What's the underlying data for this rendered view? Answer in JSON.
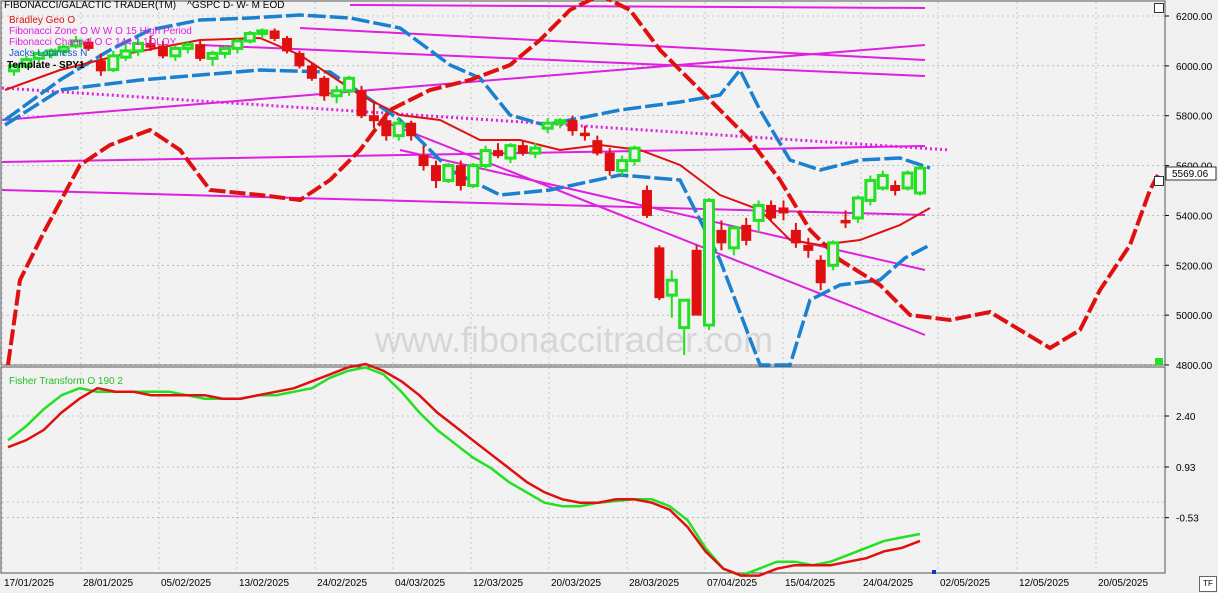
{
  "header": {
    "app_title": "FIBONACCI/GALACTIC TRADER(TM)",
    "symbol_line": "^GSPC D- W- M EOD",
    "indicators": [
      {
        "label": "Bradley Geo O",
        "color": "#e01010"
      },
      {
        "label": "Fibonacci Zone O  W W O 15 High Period",
        "color": "#e020e0"
      },
      {
        "label": "Fibonacci Channel O C 144 1 1OLOY",
        "color": "#e020e0"
      },
      {
        "label": "Jacks Lopiness N",
        "color": "#1060d0"
      }
    ],
    "template": "Template - SPY1"
  },
  "watermark": "www.fibonaccitrader.com",
  "price_axis": {
    "ticks": [
      "6200.00",
      "6000.00",
      "5800.00",
      "5600.00",
      "5400.00",
      "5200.00",
      "5000.00",
      "4800.00"
    ],
    "last_price": "5569.06"
  },
  "lower_panel": {
    "title": "Fisher Transform O 190 2",
    "ticks": [
      "2.40",
      "0.93",
      "-0.53"
    ]
  },
  "x_axis": {
    "dates": [
      "17/01/2025",
      "28/01/2025",
      "05/02/2025",
      "13/02/2025",
      "24/02/2025",
      "04/03/2025",
      "12/03/2025",
      "20/03/2025",
      "28/03/2025",
      "07/04/2025",
      "15/04/2025",
      "24/04/2025",
      "02/05/2025",
      "12/05/2025",
      "20/05/2025"
    ]
  },
  "buttons": {
    "tf": "TF"
  },
  "colors": {
    "up": "#22e022",
    "down": "#e01010",
    "bradley": "#e01010",
    "fib": "#e020e0",
    "jacks": "#1a80d0",
    "fisher_a": "#22e022",
    "fisher_b": "#e01010"
  },
  "chart_data": [
    {
      "type": "candlestick",
      "title": "^GSPC D- W- M EOD",
      "ylim": [
        4800,
        6300
      ],
      "y_ticks": [
        6200,
        6000,
        5800,
        5600,
        5400,
        5200,
        5000,
        4800
      ],
      "x_tick_labels": [
        "17/01/2025",
        "28/01/2025",
        "05/02/2025",
        "13/02/2025",
        "24/02/2025",
        "04/03/2025",
        "12/03/2025",
        "20/03/2025",
        "28/03/2025",
        "07/04/2025",
        "15/04/2025",
        "24/04/2025",
        "02/05/2025",
        "12/05/2025",
        "20/05/2025"
      ],
      "last_price": 5569.06,
      "candles": [
        {
          "o": 5980,
          "h": 6010,
          "l": 5960,
          "c": 6000
        },
        {
          "o": 6000,
          "h": 6040,
          "l": 5990,
          "c": 6025
        },
        {
          "o": 6030,
          "h": 6060,
          "l": 6015,
          "c": 6050
        },
        {
          "o": 6045,
          "h": 6070,
          "l": 6030,
          "c": 6060
        },
        {
          "o": 6060,
          "h": 6085,
          "l": 6040,
          "c": 6075
        },
        {
          "o": 6080,
          "h": 6120,
          "l": 6070,
          "c": 6100
        },
        {
          "o": 6095,
          "h": 6110,
          "l": 6060,
          "c": 6070
        },
        {
          "o": 6020,
          "h": 6050,
          "l": 5960,
          "c": 5980
        },
        {
          "o": 5985,
          "h": 6060,
          "l": 5975,
          "c": 6040
        },
        {
          "o": 6035,
          "h": 6090,
          "l": 6020,
          "c": 6060
        },
        {
          "o": 6060,
          "h": 6110,
          "l": 6040,
          "c": 6090
        },
        {
          "o": 6090,
          "h": 6120,
          "l": 6060,
          "c": 6075
        },
        {
          "o": 6080,
          "h": 6100,
          "l": 6030,
          "c": 6040
        },
        {
          "o": 6040,
          "h": 6080,
          "l": 6020,
          "c": 6070
        },
        {
          "o": 6070,
          "h": 6100,
          "l": 6050,
          "c": 6085
        },
        {
          "o": 6085,
          "h": 6100,
          "l": 6020,
          "c": 6030
        },
        {
          "o": 6030,
          "h": 6060,
          "l": 6000,
          "c": 6050
        },
        {
          "o": 6050,
          "h": 6080,
          "l": 6030,
          "c": 6070
        },
        {
          "o": 6070,
          "h": 6110,
          "l": 6050,
          "c": 6100
        },
        {
          "o": 6100,
          "h": 6140,
          "l": 6090,
          "c": 6130
        },
        {
          "o": 6130,
          "h": 6150,
          "l": 6110,
          "c": 6140
        },
        {
          "o": 6140,
          "h": 6150,
          "l": 6100,
          "c": 6110
        },
        {
          "o": 6110,
          "h": 6120,
          "l": 6050,
          "c": 6060
        },
        {
          "o": 6050,
          "h": 6060,
          "l": 5990,
          "c": 6000
        },
        {
          "o": 6000,
          "h": 6010,
          "l": 5940,
          "c": 5950
        },
        {
          "o": 5950,
          "h": 5960,
          "l": 5860,
          "c": 5880
        },
        {
          "o": 5880,
          "h": 5920,
          "l": 5850,
          "c": 5900
        },
        {
          "o": 5900,
          "h": 5960,
          "l": 5880,
          "c": 5950
        },
        {
          "o": 5900,
          "h": 5920,
          "l": 5790,
          "c": 5800
        },
        {
          "o": 5800,
          "h": 5850,
          "l": 5750,
          "c": 5780
        },
        {
          "o": 5780,
          "h": 5800,
          "l": 5700,
          "c": 5720
        },
        {
          "o": 5720,
          "h": 5790,
          "l": 5700,
          "c": 5770
        },
        {
          "o": 5770,
          "h": 5780,
          "l": 5700,
          "c": 5720
        },
        {
          "o": 5640,
          "h": 5680,
          "l": 5580,
          "c": 5600
        },
        {
          "o": 5600,
          "h": 5620,
          "l": 5510,
          "c": 5540
        },
        {
          "o": 5540,
          "h": 5610,
          "l": 5530,
          "c": 5600
        },
        {
          "o": 5600,
          "h": 5620,
          "l": 5500,
          "c": 5520
        },
        {
          "o": 5520,
          "h": 5610,
          "l": 5510,
          "c": 5600
        },
        {
          "o": 5600,
          "h": 5680,
          "l": 5580,
          "c": 5660
        },
        {
          "o": 5660,
          "h": 5690,
          "l": 5630,
          "c": 5640
        },
        {
          "o": 5630,
          "h": 5690,
          "l": 5610,
          "c": 5680
        },
        {
          "o": 5680,
          "h": 5700,
          "l": 5640,
          "c": 5650
        },
        {
          "o": 5650,
          "h": 5690,
          "l": 5630,
          "c": 5670
        },
        {
          "o": 5750,
          "h": 5790,
          "l": 5730,
          "c": 5770
        },
        {
          "o": 5770,
          "h": 5790,
          "l": 5750,
          "c": 5780
        },
        {
          "o": 5780,
          "h": 5800,
          "l": 5720,
          "c": 5740
        },
        {
          "o": 5730,
          "h": 5760,
          "l": 5700,
          "c": 5720
        },
        {
          "o": 5700,
          "h": 5720,
          "l": 5640,
          "c": 5650
        },
        {
          "o": 5650,
          "h": 5670,
          "l": 5560,
          "c": 5580
        },
        {
          "o": 5580,
          "h": 5640,
          "l": 5560,
          "c": 5620
        },
        {
          "o": 5620,
          "h": 5680,
          "l": 5600,
          "c": 5670
        },
        {
          "o": 5500,
          "h": 5520,
          "l": 5390,
          "c": 5400
        },
        {
          "o": 5270,
          "h": 5280,
          "l": 5060,
          "c": 5070
        },
        {
          "o": 5080,
          "h": 5180,
          "l": 4990,
          "c": 5140
        },
        {
          "o": 4950,
          "h": 5060,
          "l": 4840,
          "c": 5060
        },
        {
          "o": 5260,
          "h": 5280,
          "l": 5000,
          "c": 5000
        },
        {
          "o": 4960,
          "h": 5470,
          "l": 4940,
          "c": 5460
        },
        {
          "o": 5340,
          "h": 5380,
          "l": 5260,
          "c": 5290
        },
        {
          "o": 5270,
          "h": 5360,
          "l": 5240,
          "c": 5350
        },
        {
          "o": 5360,
          "h": 5390,
          "l": 5280,
          "c": 5300
        },
        {
          "o": 5380,
          "h": 5460,
          "l": 5330,
          "c": 5440
        },
        {
          "o": 5440,
          "h": 5460,
          "l": 5380,
          "c": 5390
        },
        {
          "o": 5430,
          "h": 5460,
          "l": 5380,
          "c": 5410
        },
        {
          "o": 5340,
          "h": 5370,
          "l": 5270,
          "c": 5290
        },
        {
          "o": 5280,
          "h": 5310,
          "l": 5230,
          "c": 5260
        },
        {
          "o": 5220,
          "h": 5240,
          "l": 5100,
          "c": 5130
        },
        {
          "o": 5200,
          "h": 5300,
          "l": 5180,
          "c": 5290
        },
        {
          "o": 5380,
          "h": 5420,
          "l": 5350,
          "c": 5370
        },
        {
          "o": 5390,
          "h": 5480,
          "l": 5370,
          "c": 5470
        },
        {
          "o": 5460,
          "h": 5560,
          "l": 5440,
          "c": 5540
        },
        {
          "o": 5510,
          "h": 5580,
          "l": 5500,
          "c": 5560
        },
        {
          "o": 5520,
          "h": 5540,
          "l": 5480,
          "c": 5500
        },
        {
          "o": 5510,
          "h": 5580,
          "l": 5500,
          "c": 5570
        },
        {
          "o": 5490,
          "h": 5600,
          "l": 5480,
          "c": 5590
        }
      ]
    },
    {
      "type": "line",
      "title": "Fisher Transform O 190 2",
      "y_ticks": [
        2.4,
        0.93,
        -0.53
      ],
      "series": [
        {
          "values": [
            1.7,
            2.1,
            2.6,
            3.0,
            3.2,
            3.1,
            3.1,
            3.1,
            3.1,
            3.1,
            3.0,
            2.9,
            2.9,
            2.9,
            3.0,
            3.0,
            3.1,
            3.2,
            3.5,
            3.7,
            3.8,
            3.6,
            3.1,
            2.5,
            2.0,
            1.6,
            1.2,
            0.9,
            0.5,
            0.2,
            -0.1,
            -0.2,
            -0.2,
            -0.1,
            -0.05,
            0.0,
            0.0,
            -0.2,
            -0.6,
            -1.4,
            -2.0,
            -2.2,
            -2.0,
            -1.8,
            -1.8,
            -1.9,
            -1.8,
            -1.6,
            -1.4,
            -1.2,
            -1.1,
            -1.0
          ]
        },
        {
          "values": [
            1.5,
            1.7,
            2.0,
            2.5,
            2.9,
            3.2,
            3.1,
            3.1,
            3.0,
            3.0,
            3.0,
            3.0,
            2.9,
            2.9,
            3.0,
            3.1,
            3.2,
            3.4,
            3.6,
            3.8,
            3.9,
            3.7,
            3.4,
            3.0,
            2.5,
            2.1,
            1.7,
            1.3,
            0.9,
            0.5,
            0.2,
            0.0,
            -0.1,
            -0.1,
            0.0,
            0.0,
            -0.1,
            -0.3,
            -0.8,
            -1.5,
            -2.0,
            -2.2,
            -2.2,
            -2.0,
            -1.9,
            -1.9,
            -1.9,
            -1.8,
            -1.7,
            -1.5,
            -1.4,
            -1.2
          ]
        }
      ]
    }
  ]
}
